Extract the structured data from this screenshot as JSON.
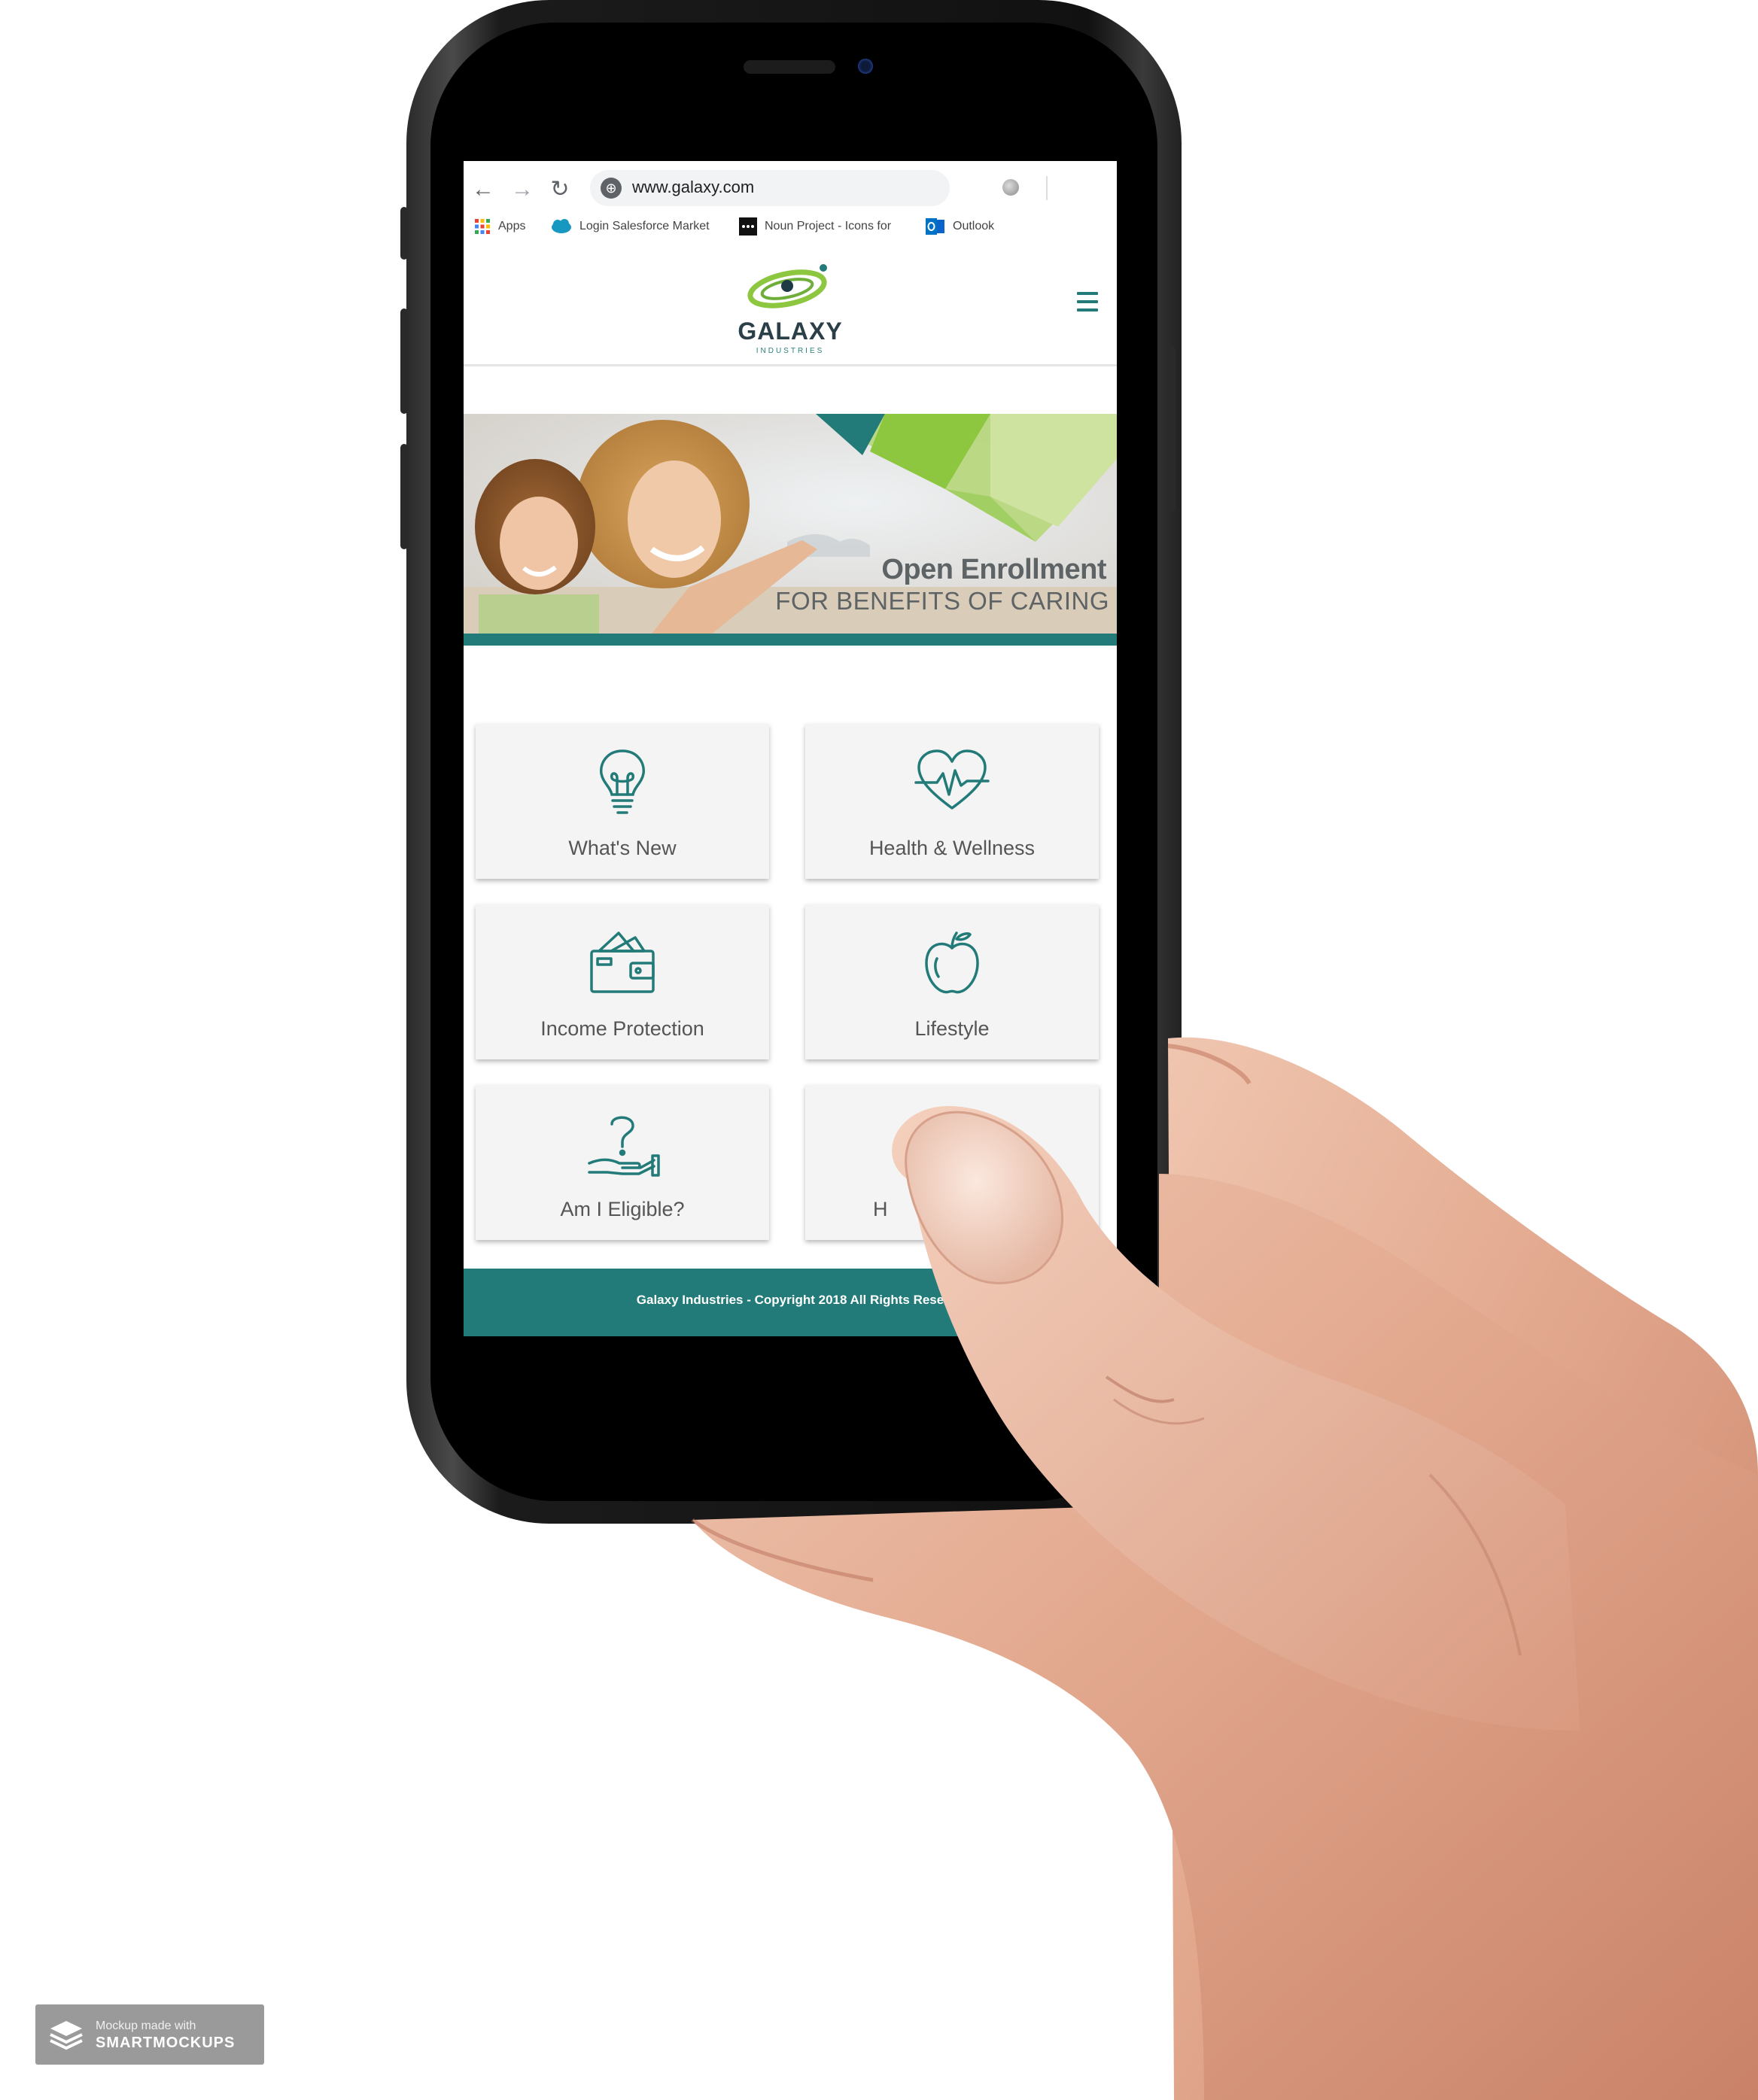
{
  "browser": {
    "url": "www.galaxy.com",
    "bookmarks": [
      {
        "label": "Apps"
      },
      {
        "label": "Login  Salesforce Market"
      },
      {
        "label": "Noun Project - Icons for"
      },
      {
        "label": "Outlook"
      }
    ]
  },
  "site": {
    "logo": {
      "name": "GALAXY",
      "sub": "INDUSTRIES"
    },
    "banner": {
      "title": "Open Enrollment",
      "subtitle": "FOR BENEFITS OF CARING"
    },
    "tiles": [
      {
        "label": "What's New",
        "icon": "lightbulb-icon"
      },
      {
        "label": "Health & Wellness",
        "icon": "heart-pulse-icon"
      },
      {
        "label": "Income Protection",
        "icon": "wallet-icon"
      },
      {
        "label": "Lifestyle",
        "icon": "apple-icon"
      },
      {
        "label": "Am I Eligible?",
        "icon": "question-hand-icon"
      },
      {
        "label": "H",
        "icon": "document-pen-icon"
      }
    ],
    "footer": "Galaxy Industries - Copyright 2018 All Rights Rese"
  },
  "watermark": {
    "line1": "Mockup made with",
    "line2": "SMARTMOCKUPS"
  },
  "colors": {
    "brand_teal": "#227b78",
    "brand_green": "#8dc63f",
    "tile_bg": "#f4f4f4"
  }
}
